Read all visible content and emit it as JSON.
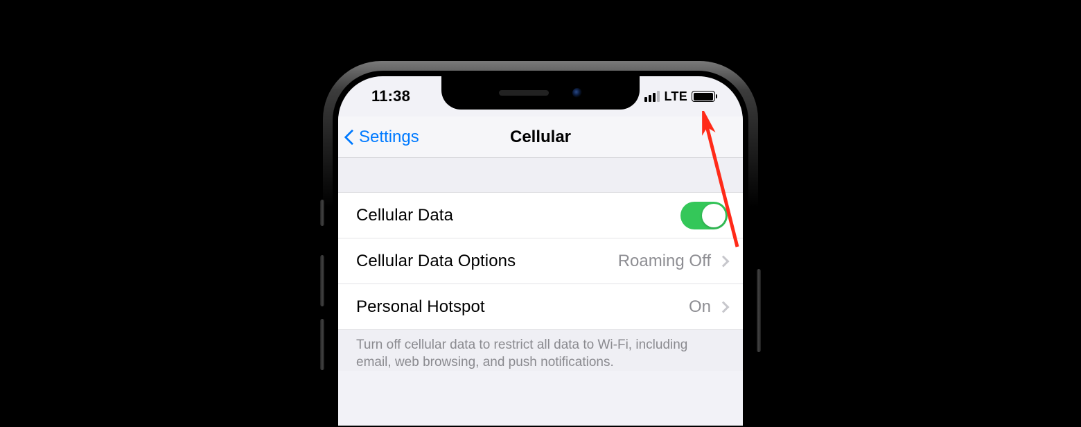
{
  "status_bar": {
    "time": "11:38",
    "network_label": "LTE"
  },
  "nav": {
    "back_label": "Settings",
    "title": "Cellular"
  },
  "rows": {
    "cellular_data": {
      "label": "Cellular Data",
      "toggle_on": true
    },
    "options": {
      "label": "Cellular Data Options",
      "value": "Roaming Off"
    },
    "hotspot": {
      "label": "Personal Hotspot",
      "value": "On"
    }
  },
  "footer": "Turn off cellular data to restrict all data to Wi-Fi, including email, web browsing, and push notifications.",
  "colors": {
    "accent": "#007aff",
    "toggle_on": "#34c759",
    "annotation": "#ff2a18"
  }
}
